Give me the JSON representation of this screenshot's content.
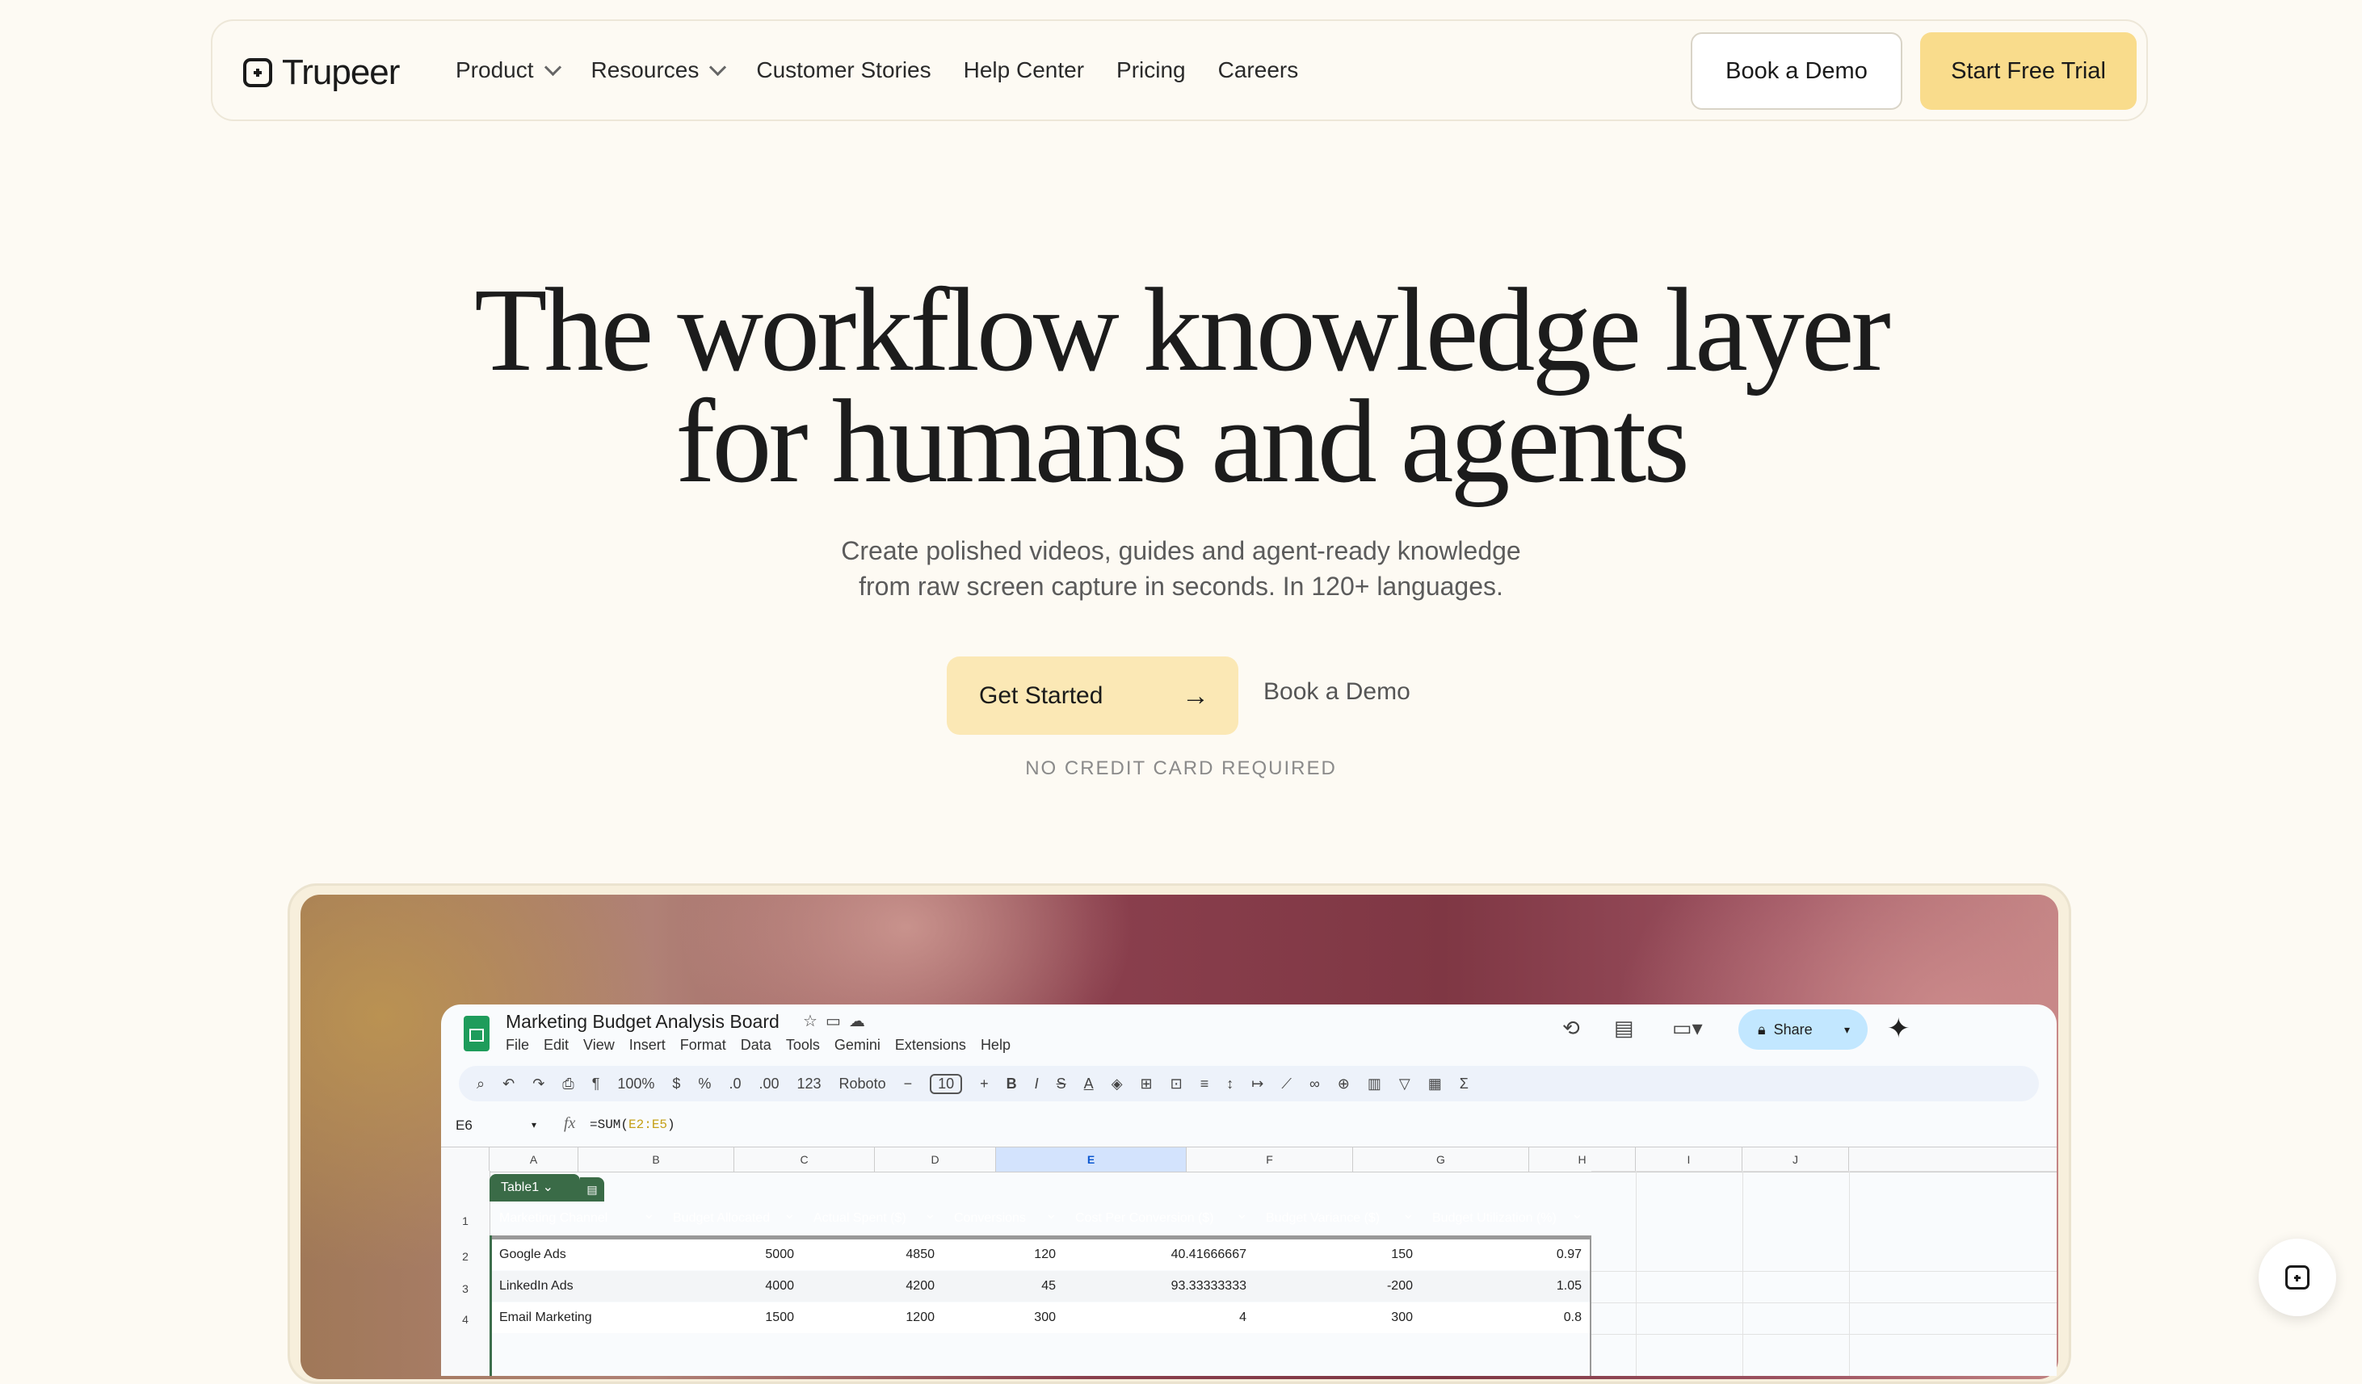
{
  "nav": {
    "logo_text": "Trupeer",
    "links": [
      {
        "label": "Product",
        "has_dropdown": true
      },
      {
        "label": "Resources",
        "has_dropdown": true
      },
      {
        "label": "Customer Stories",
        "has_dropdown": false
      },
      {
        "label": "Help Center",
        "has_dropdown": false
      },
      {
        "label": "Pricing",
        "has_dropdown": false
      },
      {
        "label": "Careers",
        "has_dropdown": false
      }
    ],
    "book_demo": "Book a Demo",
    "start_trial": "Start Free Trial"
  },
  "hero": {
    "title_line1": "The workflow knowledge layer",
    "title_line2": "for humans and agents",
    "subtitle_line1": "Create polished videos, guides and agent-ready knowledge",
    "subtitle_line2": "from raw screen capture in seconds. In 120+ languages.",
    "get_started": "Get Started",
    "book_demo": "Book a Demo",
    "no_cc": "NO CREDIT CARD REQUIRED"
  },
  "sheet": {
    "title": "Marketing Budget Analysis Board",
    "menu": [
      "File",
      "Edit",
      "View",
      "Insert",
      "Format",
      "Data",
      "Tools",
      "Gemini",
      "Extensions",
      "Help"
    ],
    "share_label": "Share",
    "toolbar": {
      "zoom": "100%",
      "currency": "$",
      "percent": "%",
      "dec_less": ".0",
      "dec_more": ".00",
      "number_fmt": "123",
      "font": "Roboto",
      "font_size": "10"
    },
    "cell_ref": "E6",
    "formula_prefix": "=SUM(",
    "formula_range": "E2:E5",
    "formula_suffix": ")",
    "table_name": "Table1",
    "columns": [
      "A",
      "B",
      "C",
      "D",
      "E",
      "F",
      "G",
      "H",
      "I",
      "J"
    ],
    "selected_column": "E",
    "row_numbers": [
      "1",
      "2",
      "3",
      "4"
    ],
    "headers": [
      "Marketing Channel",
      "Budget Allocated",
      "Actual Spent ($)",
      "Conversions",
      "Cost Per Conversion ($)",
      "Budget Variance ($)",
      "Budget Utilization (%)"
    ],
    "rows": [
      [
        "Google Ads",
        "5000",
        "4850",
        "120",
        "40.41666667",
        "150",
        "0.97"
      ],
      [
        "LinkedIn Ads",
        "4000",
        "4200",
        "45",
        "93.33333333",
        "-200",
        "1.05"
      ],
      [
        "Email Marketing",
        "1500",
        "1200",
        "300",
        "4",
        "300",
        "0.8"
      ]
    ]
  },
  "colors": {
    "background": "#fdfaf3",
    "primary_button": "#f9dc8c",
    "get_started_button": "#fbe8b5",
    "sheet_header_green": "#3d6e4c"
  }
}
